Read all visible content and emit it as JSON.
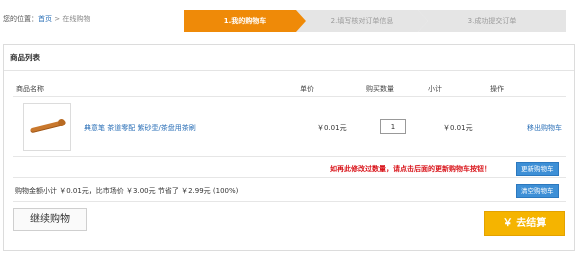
{
  "breadcrumb": {
    "prefix": "您的位置：",
    "home": "首页",
    "separator": ">",
    "current": "在线购物"
  },
  "steps": [
    {
      "label": "1.我的购物车",
      "active": true
    },
    {
      "label": "2.填写核对订单信息",
      "active": false
    },
    {
      "label": "3.成功提交订单",
      "active": false
    }
  ],
  "panel": {
    "title": "商品列表"
  },
  "table": {
    "headers": {
      "name": "商品名称",
      "price": "单价",
      "quantity": "购买数量",
      "subtotal": "小计",
      "action": "操作"
    },
    "rows": [
      {
        "name": "典意笔 茶道零配 紫砂壶/茶盘用茶刷",
        "price": "￥0.01元",
        "quantity": "1",
        "subtotal": "￥0.01元",
        "action": "移出购物车"
      }
    ]
  },
  "notice": "如再此修改过数量，请点击后面的更新购物车按钮！",
  "update_button": "更新购物车",
  "clear_button": "清空购物车",
  "summary": "购物金额小计 ￥0.01元，比市场价 ￥3.00元 节省了 ￥2.99元 (100%)",
  "continue_button": "继续购物",
  "checkout_button": "￥ 去结算",
  "colors": {
    "active_step": "#ef8a08",
    "inactive_step": "#e5e5e5",
    "link": "#2a6fb7",
    "warning": "#d9151b",
    "blue_button": "#3d8fd6",
    "checkout": "#f5b400"
  }
}
